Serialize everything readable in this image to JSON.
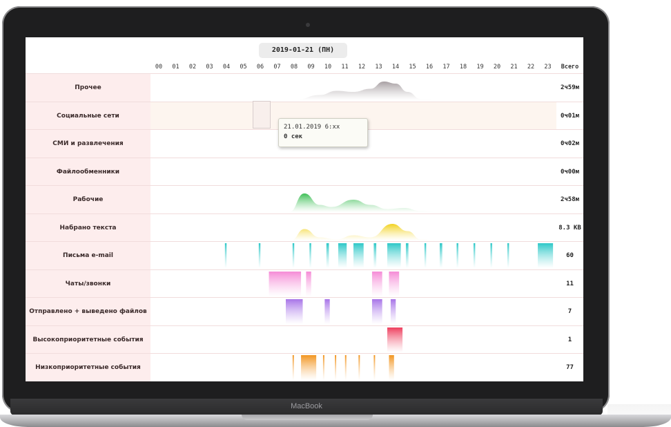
{
  "device": {
    "brand": "MacBook"
  },
  "report": {
    "date": "2019-01-21 (ПН)",
    "hours": [
      "00",
      "01",
      "02",
      "03",
      "04",
      "05",
      "06",
      "07",
      "08",
      "09",
      "10",
      "11",
      "12",
      "13",
      "14",
      "15",
      "16",
      "17",
      "18",
      "19",
      "20",
      "21",
      "22",
      "23"
    ],
    "total_header": "Всего",
    "rows": [
      {
        "label": "Прочее",
        "total": "2ч59м",
        "type": "curve",
        "color": "#a79fa2",
        "points": [
          [
            0,
            0
          ],
          [
            8.5,
            0
          ],
          [
            10,
            0.25
          ],
          [
            11,
            0.45
          ],
          [
            12,
            0.4
          ],
          [
            13,
            0.55
          ],
          [
            13.8,
            0.9
          ],
          [
            14.5,
            0.8
          ],
          [
            15.2,
            0.4
          ],
          [
            16,
            0.05
          ],
          [
            17,
            0
          ],
          [
            24,
            0
          ]
        ]
      },
      {
        "label": "Социальные сети",
        "total": "0ч01м",
        "type": "band",
        "color": "#fdf5ef"
      },
      {
        "label": "СМИ и развлечения",
        "total": "0ч02м",
        "type": "empty"
      },
      {
        "label": "Файлообменники",
        "total": "0ч00м",
        "type": "empty"
      },
      {
        "label": "Рабочие",
        "total": "2ч58м",
        "type": "curve",
        "color": "#3dbf55",
        "points": [
          [
            0,
            0
          ],
          [
            8.2,
            0
          ],
          [
            9.1,
            0.9
          ],
          [
            10,
            0.35
          ],
          [
            10.7,
            0.25
          ],
          [
            12,
            0.6
          ],
          [
            13,
            0.35
          ],
          [
            14,
            0.15
          ],
          [
            15,
            0.2
          ],
          [
            16,
            0.05
          ],
          [
            17,
            0
          ],
          [
            24,
            0
          ]
        ]
      },
      {
        "label": "Набрано текста",
        "total": "8.3 KB",
        "type": "curve",
        "color": "#f2d21e",
        "points": [
          [
            0,
            0
          ],
          [
            8.3,
            0
          ],
          [
            9.1,
            0.55
          ],
          [
            10,
            0.15
          ],
          [
            11,
            0.05
          ],
          [
            12,
            0.25
          ],
          [
            13,
            0.15
          ],
          [
            14.3,
            0.8
          ],
          [
            15.2,
            0.45
          ],
          [
            16,
            0.05
          ],
          [
            17,
            0
          ],
          [
            24,
            0
          ]
        ]
      },
      {
        "label": "Письма e-mail",
        "total": "60",
        "type": "bars",
        "color": "#2ec8c8",
        "bars": [
          [
            4.4,
            0.1
          ],
          [
            6.4,
            0.1
          ],
          [
            8.4,
            0.1
          ],
          [
            9.4,
            0.1
          ],
          [
            10.4,
            0.15
          ],
          [
            11.1,
            0.5
          ],
          [
            12.0,
            0.6
          ],
          [
            13.2,
            0.15
          ],
          [
            14.0,
            0.8
          ],
          [
            15.1,
            0.15
          ],
          [
            16.2,
            0.1
          ],
          [
            17.1,
            0.15
          ],
          [
            18.1,
            0.1
          ],
          [
            19.1,
            0.1
          ],
          [
            20.1,
            0.1
          ],
          [
            21.1,
            0.1
          ],
          [
            22.9,
            0.9
          ]
        ]
      },
      {
        "label": "Чаты/звонки",
        "total": "11",
        "type": "bars",
        "color": "#f58bd6",
        "bars": [
          [
            7.0,
            1.9
          ],
          [
            9.2,
            0.3
          ],
          [
            13.1,
            0.6
          ],
          [
            14.1,
            0.6
          ]
        ]
      },
      {
        "label": "Отправлено + выведено файлов",
        "total": "7",
        "type": "bars",
        "color": "#a874e8",
        "bars": [
          [
            8.0,
            1.0
          ],
          [
            10.3,
            0.3
          ],
          [
            13.1,
            0.6
          ],
          [
            14.2,
            0.3
          ]
        ]
      },
      {
        "label": "Высокоприоритетные события",
        "total": "1",
        "type": "bars",
        "color": "#ee3f5e",
        "bars": [
          [
            14.0,
            0.9
          ]
        ]
      },
      {
        "label": "Низкоприоритетные события",
        "total": "77",
        "type": "bars",
        "color": "#f29520",
        "bars": [
          [
            8.4,
            0.08
          ],
          [
            8.9,
            0.9
          ],
          [
            10.2,
            0.08
          ],
          [
            10.9,
            0.08
          ],
          [
            11.5,
            0.08
          ],
          [
            12.3,
            0.08
          ],
          [
            13.2,
            0.08
          ],
          [
            14.1,
            0.3
          ]
        ]
      }
    ],
    "tooltip": {
      "time": "21.01.2019 6:xx",
      "value": "0 сек"
    }
  }
}
